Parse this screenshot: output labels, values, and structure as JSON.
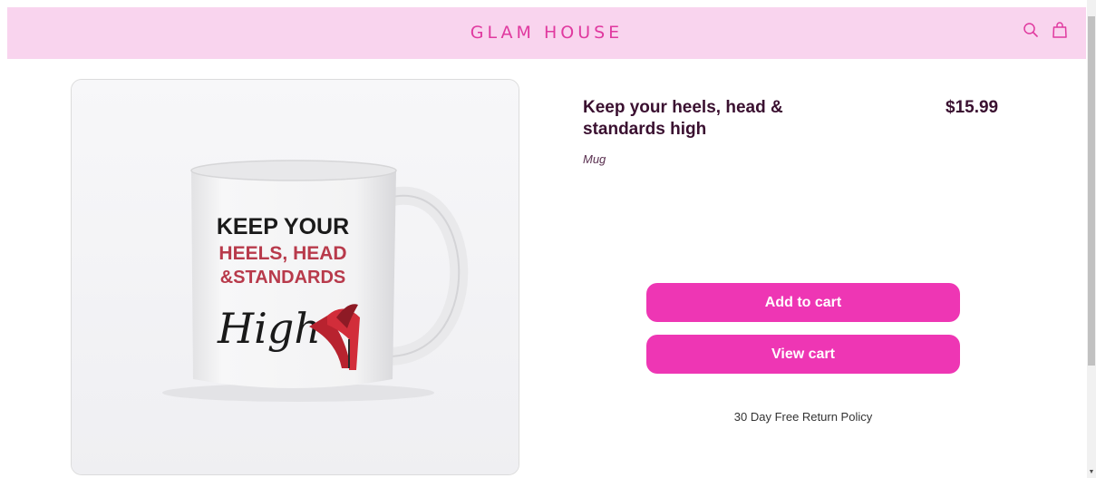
{
  "header": {
    "brand": "GLAM HOUSE",
    "icons": [
      "search-icon",
      "shopping-bag-icon"
    ]
  },
  "product": {
    "image": {
      "line1": "KEEP YOUR",
      "line2": "HEELS, HEAD",
      "line3": "&STANDARDS",
      "script_word": "High"
    },
    "title": "Keep your heels, head & standards high",
    "price": "$15.99",
    "type": "Mug"
  },
  "actions": {
    "add_to_cart": "Add to cart",
    "view_cart": "View cart"
  },
  "policy": "30 Day Free Return Policy",
  "colors": {
    "header_bg": "#f9d4ee",
    "brand": "#e0399f",
    "button": "#ee36b4",
    "title": "#3a1030",
    "mug_text_red": "#b83a4b"
  }
}
